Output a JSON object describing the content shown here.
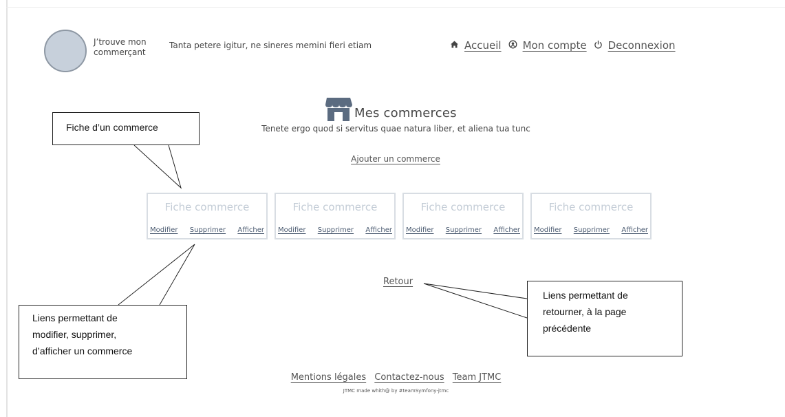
{
  "header": {
    "brand": [
      "J’trouve mon",
      "commerçant"
    ],
    "tagline": "Tanta petere igitur, ne sineres memini fieri etiam",
    "nav": [
      {
        "icon": "home-icon",
        "glyph": "⌂",
        "label": "Accueil"
      },
      {
        "icon": "account-icon",
        "glyph": "Ⓢ",
        "label": "Mon compte"
      },
      {
        "icon": "power-icon",
        "glyph": "⏻",
        "label": "Deconnexion"
      }
    ]
  },
  "main": {
    "title": "Mes commerces",
    "subtitle": "Tenete ergo quod si servitus quae natura liber, et aliena tua tunc",
    "add_link": "Ajouter un commerce",
    "cards": [
      {
        "title": "Fiche commerce",
        "links": [
          "Modifier",
          "Supprimer",
          "Afficher"
        ]
      },
      {
        "title": "Fiche commerce",
        "links": [
          "Modifier",
          "Supprimer",
          "Afficher"
        ]
      },
      {
        "title": "Fiche commerce",
        "links": [
          "Modifier",
          "Supprimer",
          "Afficher"
        ]
      },
      {
        "title": "Fiche commerce",
        "links": [
          "Modifier",
          "Supprimer",
          "Afficher"
        ]
      }
    ],
    "back_link": "Retour"
  },
  "footer": {
    "links": [
      "Mentions légales",
      "Contactez-nous",
      "Team JTMC"
    ],
    "credit": "JTMC made whith@ by #teamSymfony-jtmc"
  },
  "annotations": {
    "card_note": "Fiche d’un commerce",
    "links_note": [
      "Liens permettant de",
      "modifier, supprimer,",
      "d’afficher un commerce"
    ],
    "back_note": [
      "Liens permettant de",
      "retourner, à la page",
      "précédente"
    ]
  },
  "colors": {
    "logo_fill": "#c7d0db",
    "store_icon": "#5b6b80",
    "card_border": "#d8dde3",
    "card_title": "#c3ccd6"
  }
}
